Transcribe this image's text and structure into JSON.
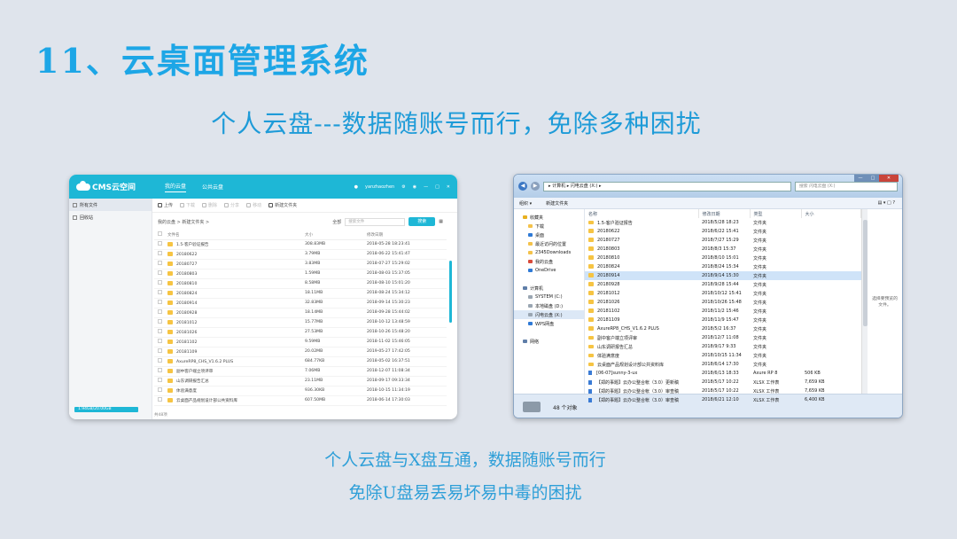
{
  "slide": {
    "title": "11、云桌面管理系统",
    "subtitle": "个人云盘---数据随账号而行，免除多种困扰",
    "caption_line1": "个人云盘与X盘互通，数据随账号而行",
    "caption_line2": "免除U盘易丢易坏易中毒的困扰"
  },
  "cms": {
    "logo": "CMS云空间",
    "nav": [
      "我的云盘",
      "公共云盘"
    ],
    "user": "yanzhaozhen",
    "sidebar": [
      "所有文件",
      "回收站"
    ],
    "quota": "1.94GB/20.00GB",
    "toolbar": [
      "上传",
      "下载",
      "删除",
      "分享",
      "移动",
      "新建文件夹"
    ],
    "breadcrumb": "我的云盘  >  新建文件夹  >",
    "search_scope": "全部",
    "search_placeholder": "搜索文件",
    "search_button": "搜索",
    "columns": [
      "文件名",
      "大小",
      "修改日期"
    ],
    "rows": [
      [
        "1.5-客户验证报告",
        "308.83MB",
        "2018-05-28 18:23:41"
      ],
      [
        "20180622",
        "3.79MB",
        "2018-06-22 15:41:47"
      ],
      [
        "20180727",
        "3.83MB",
        "2018-07-27 15:29:02"
      ],
      [
        "20180803",
        "1.59MB",
        "2018-08-03 15:37:05"
      ],
      [
        "20180810",
        "8.58MB",
        "2018-08-10 15:01:20"
      ],
      [
        "20180824",
        "18.11MB",
        "2018-08-24 15:34:12"
      ],
      [
        "20180914",
        "32.83MB",
        "2018-09-14 15:30:23"
      ],
      [
        "20180928",
        "18.14MB",
        "2018-09-28 15:44:02"
      ],
      [
        "20181012",
        "15.77MB",
        "2018-10-12 13:48:59"
      ],
      [
        "20181026",
        "27.53MB",
        "2018-10-26 15:48:20"
      ],
      [
        "20181102",
        "9.59MB",
        "2018-11-02 15:46:05"
      ],
      [
        "20181109",
        "20.02MB",
        "2019-05-27 17:42:05"
      ],
      [
        "AxureRP8_CHS_V1.6.2 PLUS",
        "684.77KB",
        "2018-05-02 16:37:51"
      ],
      [
        "副中客户端立项评审",
        "7.06MB",
        "2018-12-07 11:08:34"
      ],
      [
        "山东调研报告汇总",
        "23.11MB",
        "2018-09-17 09:33:34"
      ],
      [
        "体验满意度",
        "936.30KB",
        "2018-10-15 11:34:19"
      ],
      [
        "云桌面产品规划设计部公共资料库",
        "607.50MB",
        "2018-06-14 17:30:03"
      ]
    ],
    "footer": "共48项"
  },
  "explorer": {
    "address": "▸ 计算机 ▸ 闪电云盘 (X:) ▸",
    "search_placeholder": "搜索 闪电云盘 (X:)",
    "window_buttons": [
      "—",
      "□",
      "✕"
    ],
    "commands": [
      "组织 ▾",
      "新建文件夹"
    ],
    "tree": [
      {
        "label": "收藏夹",
        "icon": "star",
        "level": 0
      },
      {
        "label": "下载",
        "icon": "folder",
        "level": 1
      },
      {
        "label": "桌面",
        "icon": "blue",
        "level": 1
      },
      {
        "label": "最近访问的位置",
        "icon": "folder",
        "level": 1
      },
      {
        "label": "2345Downloads",
        "icon": "folder",
        "level": 1
      },
      {
        "label": "我的云盘",
        "icon": "red",
        "level": 1
      },
      {
        "label": "OneDrive",
        "icon": "blue",
        "level": 1
      },
      {
        "label": "",
        "icon": "",
        "level": 0
      },
      {
        "label": "计算机",
        "icon": "pc",
        "level": 0
      },
      {
        "label": "SYSTEM (C:)",
        "icon": "drive",
        "level": 1
      },
      {
        "label": "本地磁盘 (D:)",
        "icon": "drive",
        "level": 1
      },
      {
        "label": "闪电云盘 (X:)",
        "icon": "drive",
        "level": 1,
        "selected": true
      },
      {
        "label": "WPS网盘",
        "icon": "blue",
        "level": 1
      },
      {
        "label": "",
        "icon": "",
        "level": 0
      },
      {
        "label": "网络",
        "icon": "pc",
        "level": 0
      }
    ],
    "columns": [
      "名称",
      "修改日期",
      "类型",
      "大小"
    ],
    "rows": [
      [
        "1.5-客户验证报告",
        "2018/5/28 18:23",
        "文件夹",
        ""
      ],
      [
        "20180622",
        "2018/6/22 15:41",
        "文件夹",
        ""
      ],
      [
        "20180727",
        "2018/7/27 15:29",
        "文件夹",
        ""
      ],
      [
        "20180803",
        "2018/8/3 15:37",
        "文件夹",
        ""
      ],
      [
        "20180810",
        "2018/8/10 15:01",
        "文件夹",
        ""
      ],
      [
        "20180824",
        "2018/8/24 15:34",
        "文件夹",
        ""
      ],
      [
        "20180914",
        "2018/9/14 15:30",
        "文件夹",
        ""
      ],
      [
        "20180928",
        "2018/9/28 15:44",
        "文件夹",
        ""
      ],
      [
        "20181012",
        "2018/10/12 15:41",
        "文件夹",
        ""
      ],
      [
        "20181026",
        "2018/10/26 15:48",
        "文件夹",
        ""
      ],
      [
        "20181102",
        "2018/11/2 15:46",
        "文件夹",
        ""
      ],
      [
        "20181109",
        "2018/11/9 15:47",
        "文件夹",
        ""
      ],
      [
        "AxureRP8_CHS_V1.6.2 PLUS",
        "2018/5/2 16:37",
        "文件夹",
        ""
      ],
      [
        "副中客户端立项评审",
        "2018/12/7 11:08",
        "文件夹",
        ""
      ],
      [
        "山东调研报告汇总",
        "2018/9/17 9:33",
        "文件夹",
        ""
      ],
      [
        "体验满意度",
        "2018/10/15 11:34",
        "文件夹",
        ""
      ],
      [
        "云桌面产品规划设计部公共资料库",
        "2018/6/14 17:30",
        "文件夹",
        ""
      ],
      [
        "[06-07]sunny-3-ux",
        "2018/6/13 18:33",
        "Axure RP 8",
        "506 KB"
      ],
      [
        "【郑的事题】云办公整合帐（3.0）更新稿",
        "2018/5/17 10:22",
        "XLSX 工作表",
        "7,659 KB"
      ],
      [
        "【郑的事题】云办公整合帐（3.0）审查稿",
        "2018/5/17 10:22",
        "XLSX 工作表",
        "7,659 KB"
      ],
      [
        "【郑的事题】云办公整合帐（3.0）审查稿",
        "2018/6/21 12:10",
        "XLSX 工作表",
        "6,400 KB"
      ]
    ],
    "selected_row": 6,
    "preview_text": "选择要预览的文件。",
    "status": "48 个对象"
  }
}
